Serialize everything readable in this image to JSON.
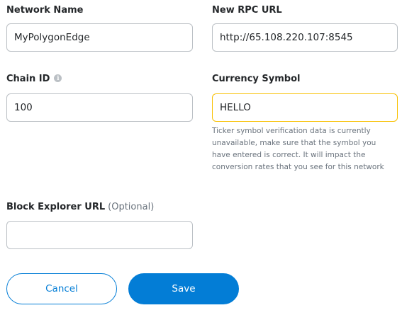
{
  "form": {
    "network_name": {
      "label": "Network Name",
      "value": "MyPolygonEdge"
    },
    "rpc_url": {
      "label": "New RPC URL",
      "value": "http://65.108.220.107:8545"
    },
    "chain_id": {
      "label": "Chain ID",
      "value": "100",
      "icon": "info-icon"
    },
    "currency_symbol": {
      "label": "Currency Symbol",
      "value": "HELLO",
      "warning_line1": "Ticker symbol verification data is currently",
      "warning_line2": "unavailable, make sure that the symbol you",
      "warning_line3": "have entered is correct. It will impact the",
      "warning_line4": "conversion rates that you see for this network",
      "warning_color": "#f8c000"
    },
    "block_explorer": {
      "label": "Block Explorer URL",
      "optional": "(Optional)",
      "value": ""
    }
  },
  "actions": {
    "cancel_label": "Cancel",
    "save_label": "Save",
    "accent_color": "#037dd6"
  }
}
